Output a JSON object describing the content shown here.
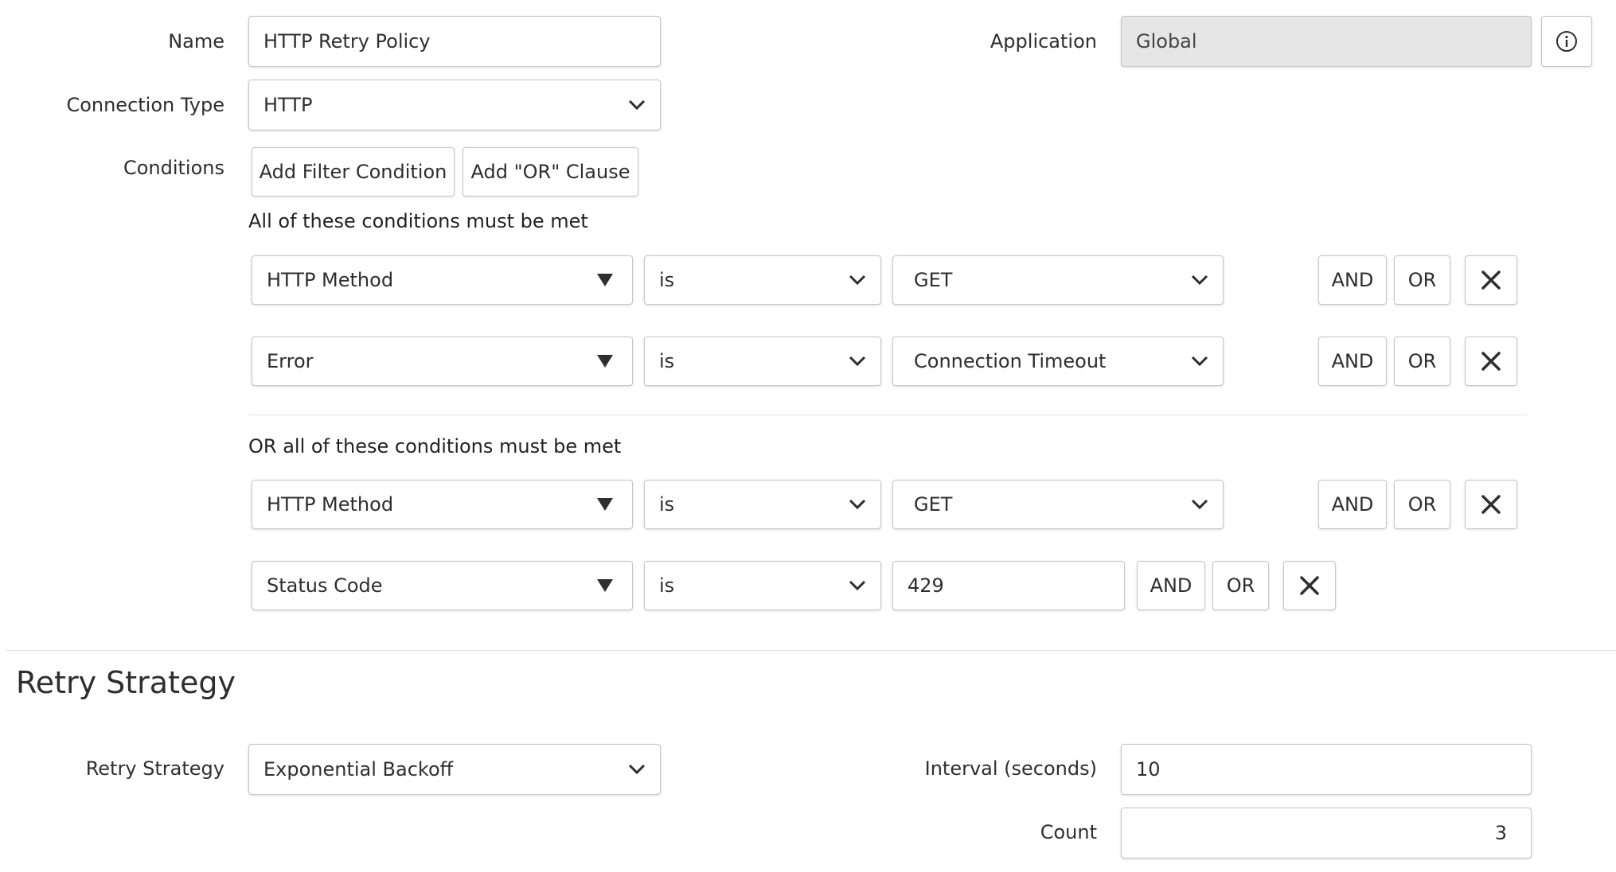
{
  "form": {
    "name": {
      "label": "Name",
      "value": "HTTP Retry Policy"
    },
    "application": {
      "label": "Application",
      "value": "Global",
      "info_icon": "info-icon"
    },
    "connection_type": {
      "label": "Connection Type",
      "value": "HTTP"
    },
    "conditions": {
      "label": "Conditions",
      "add_filter_label": "Add Filter Condition",
      "add_or_label": "Add \"OR\" Clause"
    }
  },
  "condition_groups": [
    {
      "heading": "All of these conditions must be met",
      "rows": [
        {
          "field": "HTTP Method",
          "operator": "is",
          "value": "GET"
        },
        {
          "field": "Error",
          "operator": "is",
          "value": "Connection Timeout"
        }
      ]
    },
    {
      "heading": "OR all of these conditions must be met",
      "rows": [
        {
          "field": "HTTP Method",
          "operator": "is",
          "value": "GET"
        },
        {
          "field": "Status Code",
          "operator": "is",
          "value": "429"
        }
      ]
    }
  ],
  "row_actions": {
    "and_label": "AND",
    "or_label": "OR",
    "remove_icon": "close-icon"
  },
  "retry": {
    "section_title": "Retry Strategy",
    "strategy": {
      "label": "Retry Strategy",
      "value": "Exponential Backoff"
    },
    "interval": {
      "label": "Interval (seconds)",
      "value": "10"
    },
    "count": {
      "label": "Count",
      "value": "3"
    }
  },
  "colors": {
    "border": "#c6c6c6",
    "readonly_bg": "#e6e6e6",
    "text": "#2e2e2e"
  }
}
